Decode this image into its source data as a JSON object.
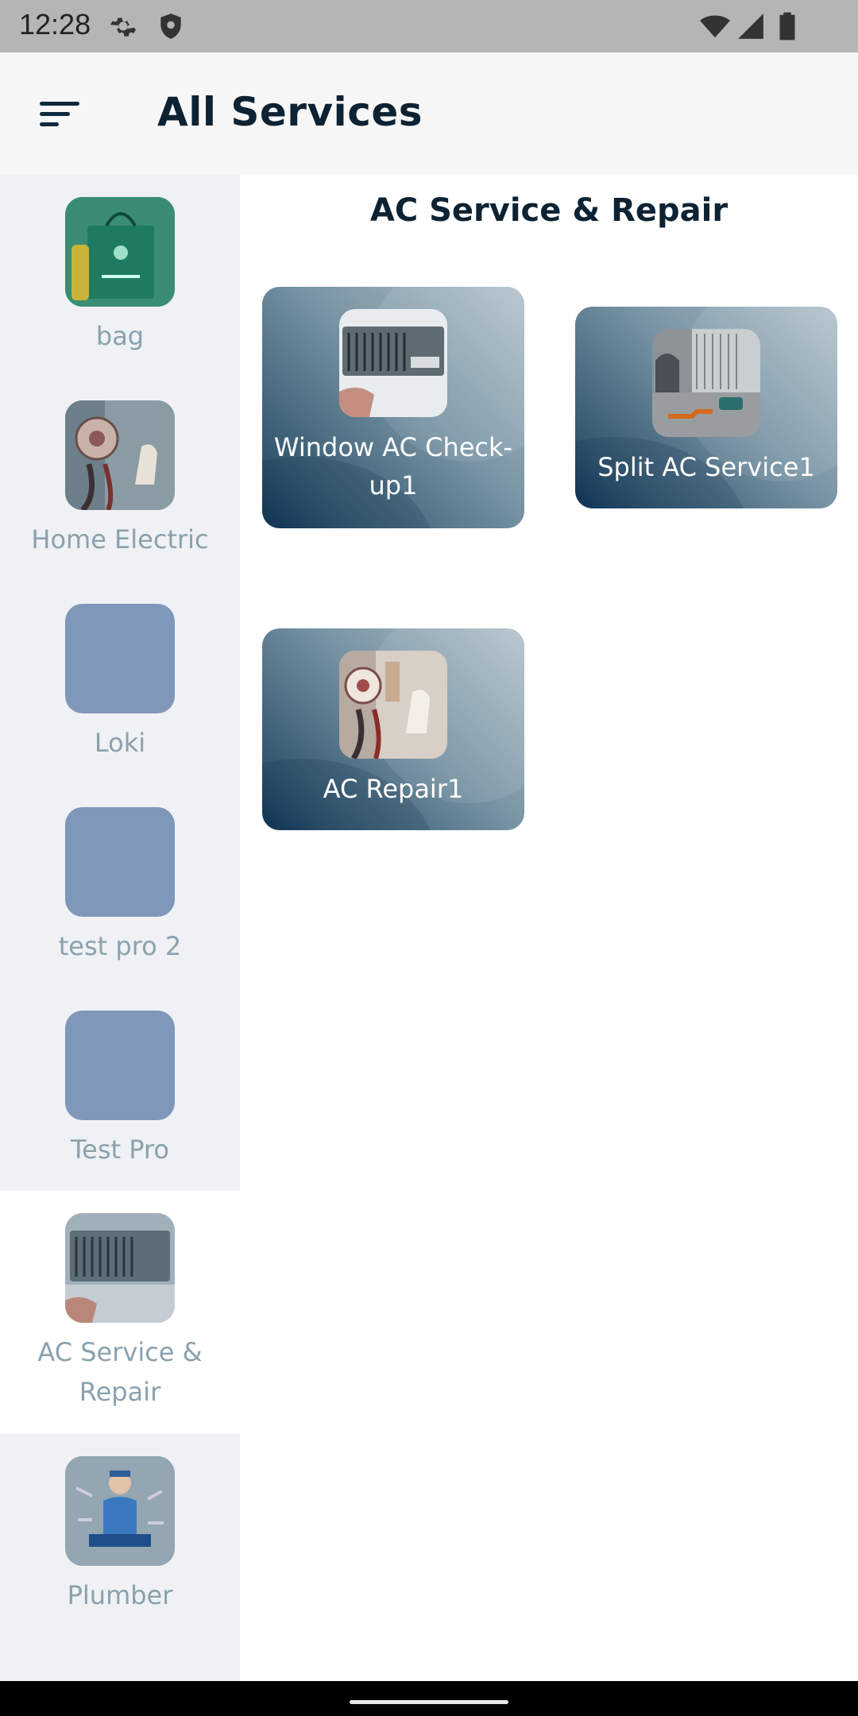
{
  "status_bar": {
    "time": "12:28",
    "icons": [
      "settings-icon",
      "shield-icon",
      "wifi-icon",
      "signal-icon",
      "battery-icon"
    ]
  },
  "app_bar": {
    "title": "All Services",
    "menu_icon": "sort-menu-icon"
  },
  "sidebar": {
    "items": [
      {
        "label": "bag",
        "thumbnail": "green-gift-bag-photo",
        "selected": false
      },
      {
        "label": "Home Electric",
        "thumbnail": "ac-gauge-photo",
        "selected": false
      },
      {
        "label": "Loki",
        "thumbnail": "blank-placeholder",
        "selected": false
      },
      {
        "label": "test pro 2",
        "thumbnail": "blank-placeholder",
        "selected": false
      },
      {
        "label": "Test Pro",
        "thumbnail": "blank-placeholder",
        "selected": false
      },
      {
        "label": "AC Service & Repair",
        "thumbnail": "window-ac-photo",
        "selected": true
      },
      {
        "label": "Plumber",
        "thumbnail": "plumber-illustration",
        "selected": false
      }
    ]
  },
  "content": {
    "section_title": "AC Service & Repair",
    "services": [
      {
        "label": "Window AC Check-up1",
        "thumbnail": "window-ac-photo"
      },
      {
        "label": "Split AC Service1",
        "thumbnail": "split-ac-repair-photo"
      },
      {
        "label": "AC Repair1",
        "thumbnail": "ac-gauge-photo"
      }
    ]
  },
  "colors": {
    "accent_dark": "#0d2232",
    "sidebar_bg": "#eff1f4",
    "sidebar_label": "#8aa1ae",
    "placeholder_thumb": "#7f98ba",
    "card_gradient_dark": "#0f3655",
    "card_gradient_light": "#b3c3cb"
  }
}
